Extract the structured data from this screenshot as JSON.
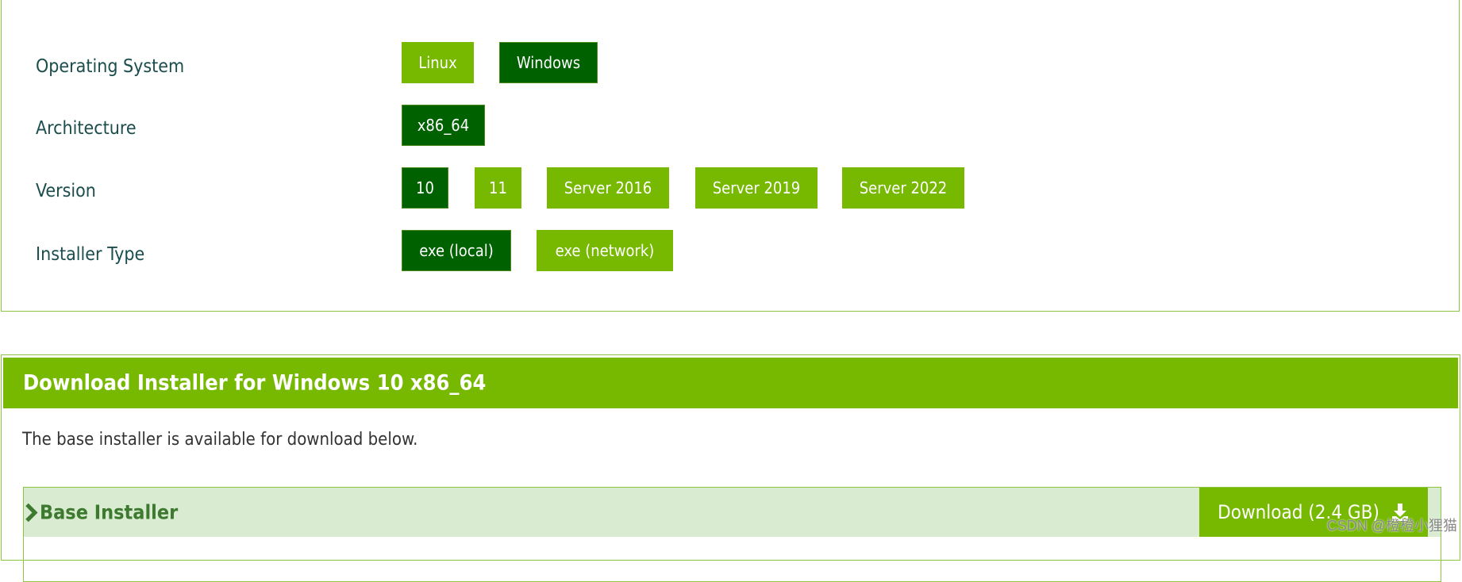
{
  "selector": {
    "rows": [
      {
        "label": "Operating System",
        "options": [
          {
            "label": "Linux",
            "selected": false
          },
          {
            "label": "Windows",
            "selected": true
          }
        ]
      },
      {
        "label": "Architecture",
        "options": [
          {
            "label": "x86_64",
            "selected": true
          }
        ]
      },
      {
        "label": "Version",
        "options": [
          {
            "label": "10",
            "selected": true
          },
          {
            "label": "11",
            "selected": false
          },
          {
            "label": "Server 2016",
            "selected": false
          },
          {
            "label": "Server 2019",
            "selected": false
          },
          {
            "label": "Server 2022",
            "selected": false
          }
        ]
      },
      {
        "label": "Installer Type",
        "options": [
          {
            "label": "exe (local)",
            "selected": true
          },
          {
            "label": "exe (network)",
            "selected": false
          }
        ]
      }
    ]
  },
  "download": {
    "title": "Download Installer for Windows 10 x86_64",
    "description": "The base installer is available for download below.",
    "base_installer": {
      "title": "Base Installer",
      "chevron_icon": "chevron-right-icon",
      "download_label": "Download (2.4 GB)",
      "download_icon": "download-icon"
    }
  },
  "watermark": "CSDN @橙橙小狸猫",
  "colors": {
    "accent": "#76b900",
    "selected": "#006100",
    "label": "#1b4d4d",
    "row_bg": "#d9ecd2"
  }
}
